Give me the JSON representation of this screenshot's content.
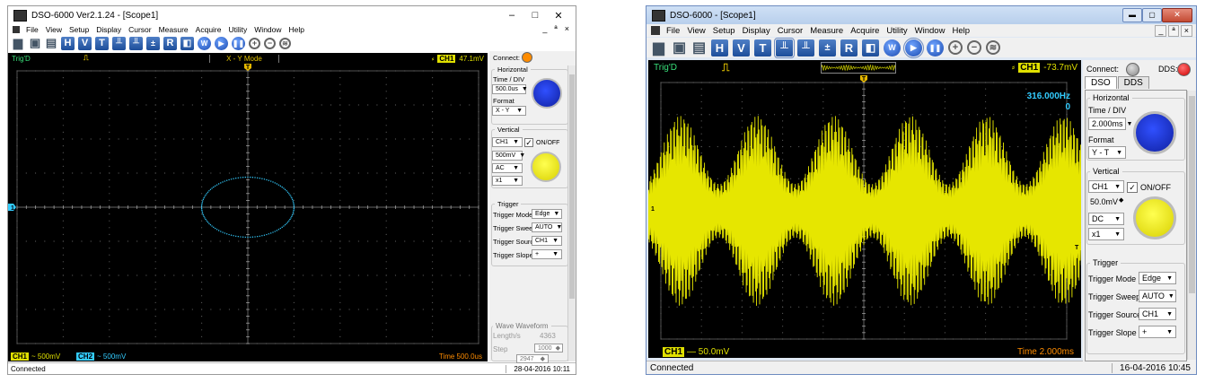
{
  "colors": {
    "scope_bg": "#000000",
    "grid": "#5a5a5a",
    "ch1": "#e6e600",
    "ch2": "#33ccff",
    "trigger_text": "#3ee07f",
    "connect_orange": "#ff8c00",
    "dds_red": "#ee1111",
    "knob_blue": "#1530c8",
    "knob_yellow": "#f2ea00"
  },
  "left": {
    "title": "DSO-6000 Ver2.1.24 - [Scope1]",
    "window_controls": {
      "minimize": "–",
      "maximize": "□",
      "close": "✕"
    },
    "mdi_controls": {
      "minimize": "_",
      "restore": "ª",
      "close": "×"
    },
    "menu": [
      "File",
      "View",
      "Setup",
      "Display",
      "Cursor",
      "Measure",
      "Acquire",
      "Utility",
      "Window",
      "Help"
    ],
    "info": {
      "trig": "Trig'D",
      "mode": "X - Y Mode",
      "ch": "CH1",
      "value": "47.1mV"
    },
    "connect_label": "Connect:",
    "horizontal": {
      "title": "Horizontal",
      "time_div_label": "Time / DIV",
      "time_div": "500.0us",
      "format_label": "Format",
      "format": "X - Y"
    },
    "vertical": {
      "title": "Vertical",
      "channel": "CH1",
      "onoff": "ON/OFF",
      "volts": "500mV",
      "coupling": "AC",
      "probe": "x1"
    },
    "trigger": {
      "title": "Trigger",
      "mode_label": "Trigger Mode",
      "mode": "Edge",
      "sweep_label": "Trigger Sweep",
      "sweep": "AUTO",
      "source_label": "Trigger Source",
      "source": "CH1",
      "slope_label": "Trigger Slope",
      "slope": "+"
    },
    "wave": {
      "title": "Wave Waveform",
      "length_label": "Length/s",
      "length_value": "4363",
      "step_label": "Step",
      "step_value": "1000",
      "pos_value": "2947"
    },
    "bottom": {
      "ch1": "CH1",
      "ch1_value": "~ 500mV",
      "ch2": "CH2",
      "ch2_value": "~ 500mV",
      "time": "Time 500.0us"
    },
    "status": "Connected",
    "date": "28-04-2016  10:11"
  },
  "right": {
    "title": "DSO-6000 - [Scope1]",
    "window_controls": {
      "minimize": "▬",
      "maximize": "▢",
      "close": "✕"
    },
    "mdi_controls": {
      "minimize": "_",
      "restore": "ª",
      "close": "×"
    },
    "menu": [
      "File",
      "View",
      "Setup",
      "Display",
      "Cursor",
      "Measure",
      "Acquire",
      "Utility",
      "Window",
      "Help"
    ],
    "info": {
      "trig": "Trig'D",
      "ch": "CH1",
      "value": "-73.7mV"
    },
    "connect_label": "Connect:",
    "dds_label": "DDS:",
    "tabs": [
      "DSO",
      "DDS"
    ],
    "horizontal": {
      "title": "Horizontal",
      "time_div_label": "Time / DIV",
      "time_div": "2.000ms",
      "format_label": "Format",
      "format": "Y - T"
    },
    "vertical": {
      "title": "Vertical",
      "channel": "CH1",
      "onoff": "ON/OFF",
      "volts": "50.0mV",
      "coupling": "DC",
      "probe": "x1"
    },
    "trigger": {
      "title": "Trigger",
      "mode_label": "Trigger Mode",
      "mode": "Edge",
      "sweep_label": "Trigger Sweep",
      "sweep": "AUTO",
      "source_label": "Trigger Source",
      "source": "CH1",
      "slope_label": "Trigger Slope",
      "slope": "+"
    },
    "freq": "316.000Hz",
    "freq_sub": "0",
    "bottom": {
      "ch1": "CH1",
      "ch1_value": "— 50.0mV",
      "time": "Time 2.000ms"
    },
    "status": "Connected",
    "date": "16-04-2016  10:45"
  }
}
